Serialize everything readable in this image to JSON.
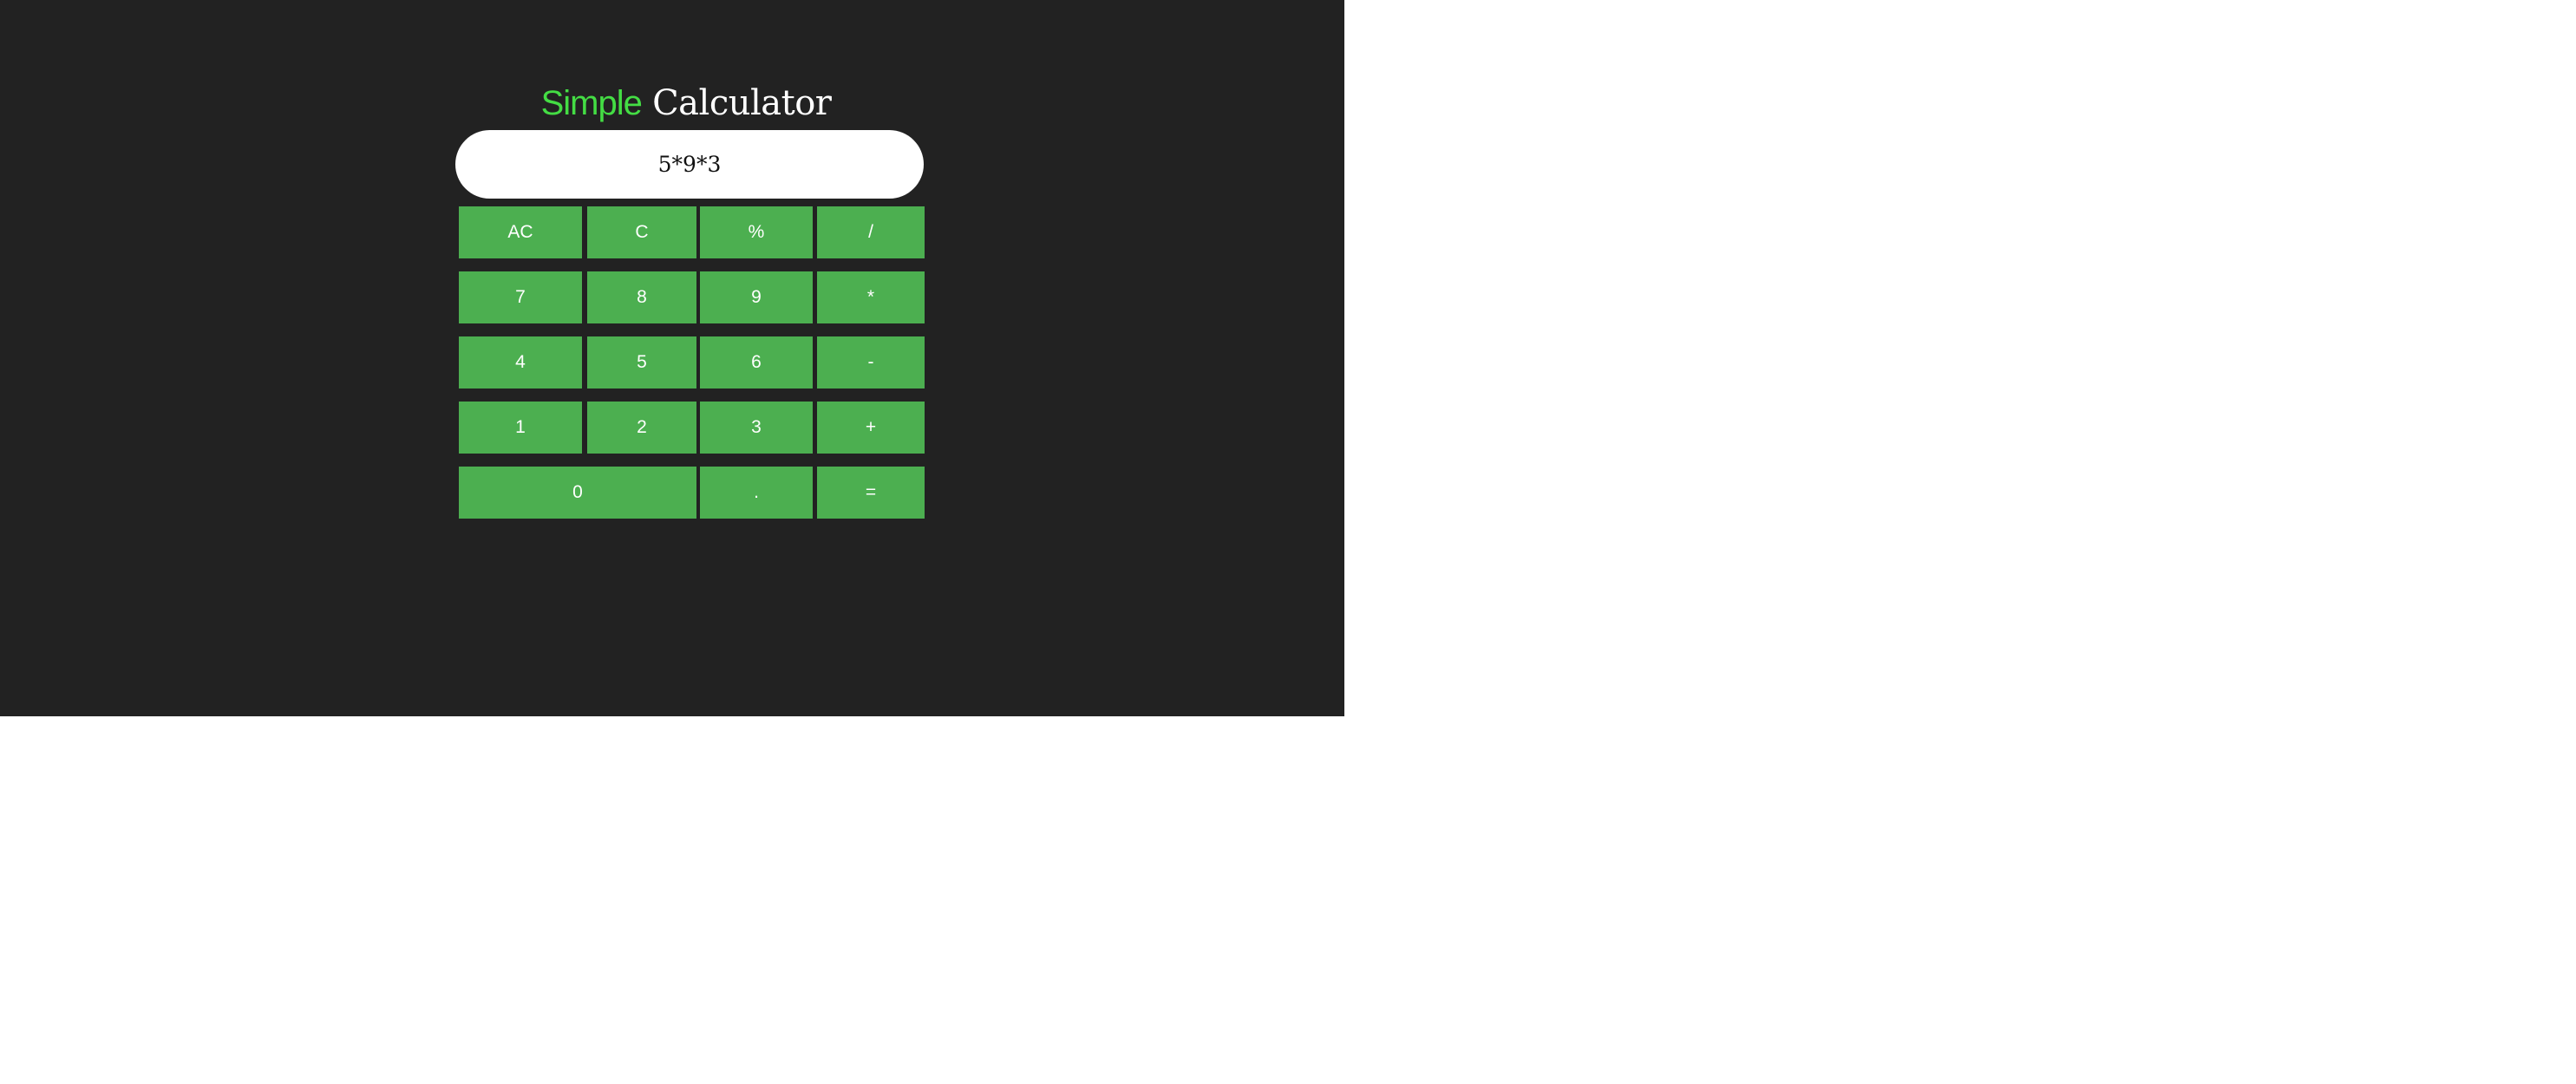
{
  "title": {
    "part1": "Simple",
    "part2": "Calculator"
  },
  "display": {
    "value": "5*9*3"
  },
  "keys": {
    "ac": "AC",
    "c": "C",
    "percent": "%",
    "divide": "/",
    "seven": "7",
    "eight": "8",
    "nine": "9",
    "multiply": "*",
    "four": "4",
    "five": "5",
    "six": "6",
    "minus": "-",
    "one": "1",
    "two": "2",
    "three": "3",
    "plus": "+",
    "zero": "0",
    "dot": ".",
    "equals": "="
  },
  "colors": {
    "background": "#222222",
    "button": "#4caf50",
    "title_accent": "#44dd44",
    "display_bg": "#ffffff"
  }
}
